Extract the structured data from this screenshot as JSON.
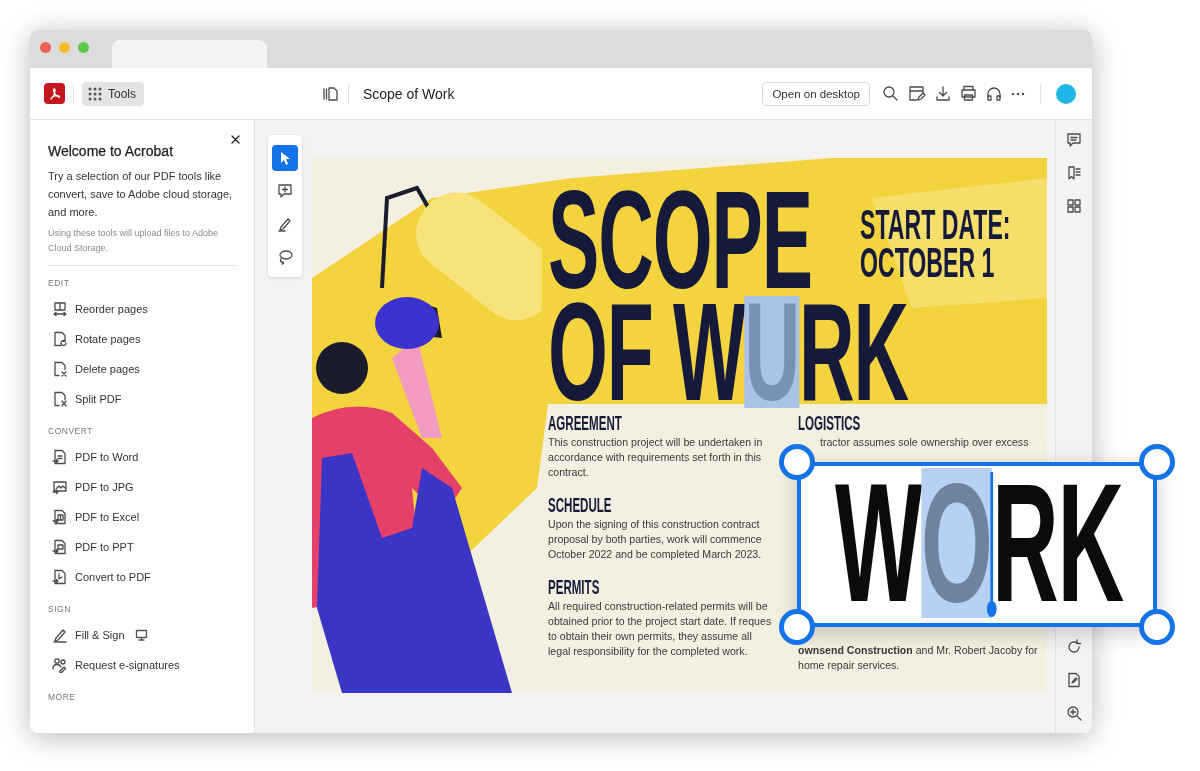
{
  "app_bar": {
    "tools_label": "Tools",
    "document_title": "Scope of Work",
    "open_button": "Open on desktop"
  },
  "sidebar": {
    "title": "Welcome to Acrobat",
    "description": "Try a selection of our PDF tools like convert, save to Adobe cloud storage, and more.",
    "note": "Using these tools will upload files to Adobe Cloud Storage.",
    "sections": [
      {
        "label": "EDIT",
        "items": [
          {
            "label": "Reorder pages",
            "desktop": false
          },
          {
            "label": "Rotate pages",
            "desktop": false
          },
          {
            "label": "Delete pages",
            "desktop": false
          },
          {
            "label": "Split PDF",
            "desktop": false
          }
        ]
      },
      {
        "label": "CONVERT",
        "items": [
          {
            "label": "PDF to Word",
            "desktop": false
          },
          {
            "label": "PDF to JPG",
            "desktop": false
          },
          {
            "label": "PDF to Excel",
            "desktop": false
          },
          {
            "label": "PDF to PPT",
            "desktop": false
          },
          {
            "label": "Convert to PDF",
            "desktop": false
          }
        ]
      },
      {
        "label": "SIGN",
        "items": [
          {
            "label": "Fill & Sign",
            "desktop": true
          },
          {
            "label": "Request e-signatures",
            "desktop": false
          }
        ]
      },
      {
        "label": "MORE"
      }
    ]
  },
  "tool_strip": [
    {
      "selected": true
    },
    {
      "selected": false
    },
    {
      "selected": false
    },
    {
      "selected": false
    }
  ],
  "document": {
    "title_lines": [
      [
        {
          "text": "SCOPE",
          "selected": false
        }
      ],
      [
        {
          "text": "OF W",
          "selected": false
        },
        {
          "text": "U",
          "selected": true
        },
        {
          "text": "RK",
          "selected": false
        }
      ]
    ],
    "date_lines": [
      "START DATE:",
      "OCTOBER 1"
    ],
    "sections": [
      {
        "heading": "AGREEMENT",
        "body": "This construction project will be undertaken in accordance with requirements set forth in this contract."
      },
      {
        "heading": "SCHEDULE",
        "body": "Upon the signing of this construction contract proposal by both parties, work will commence October 2022 and be completed March 2023."
      },
      {
        "heading": "PERMITS",
        "body": "All required construction-related permits will be obtained prior to the project start date. If reques to obtain their own permits, they assume all legal responsibility for the completed work."
      }
    ],
    "logistics": {
      "heading": "LOGISTICS",
      "paragraphs": [
        "tractor assumes sole ownership over excess",
        "**ownsend Construction** and Mr. Robert Jacoby for home repair services."
      ]
    }
  },
  "zoom_callout": {
    "segments": [
      {
        "text": "W",
        "selected": false
      },
      {
        "text": "O",
        "selected": true
      },
      {
        "text": "RK",
        "selected": false
      }
    ]
  }
}
